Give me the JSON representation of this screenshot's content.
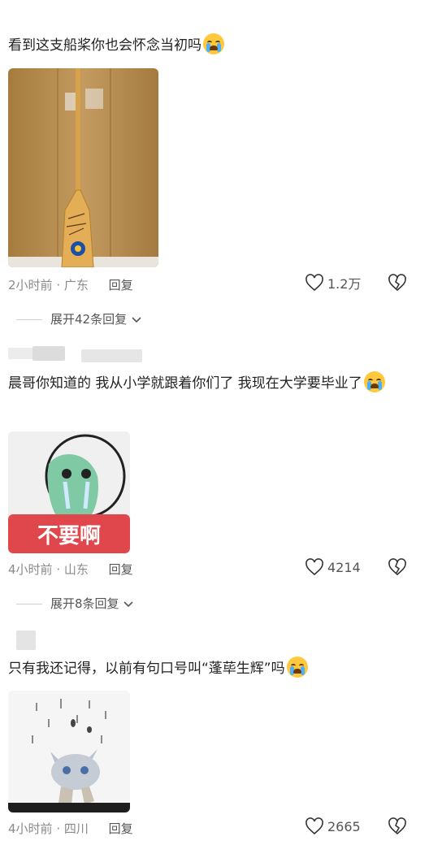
{
  "comments": [
    {
      "text": "看到这支船桨你也会怀念当初吗",
      "emoji": "loudly-crying-face",
      "time": "2小时前",
      "location": "广东",
      "reply_label": "回复",
      "likes": "1.2万",
      "expand_label": "展开42条回复"
    },
    {
      "text": "晨哥你知道的 我从小学就跟着你们了 我现在大学要毕业了",
      "emoji": "loudly-crying-face",
      "image_caption": "不要啊",
      "time": "4小时前",
      "location": "山东",
      "reply_label": "回复",
      "likes": "4214",
      "expand_label": "展开8条回复"
    },
    {
      "text": "只有我还记得，以前有句口号叫“蓬荜生辉”吗",
      "emoji": "loudly-crying-face",
      "time": "4小时前",
      "location": "四川",
      "reply_label": "回复",
      "likes": "2665"
    }
  ],
  "colors": {
    "text": "#222222",
    "meta": "#8a8a8a",
    "sticker_red": "#e0474c",
    "paddle_bg": "#b48a4e"
  }
}
